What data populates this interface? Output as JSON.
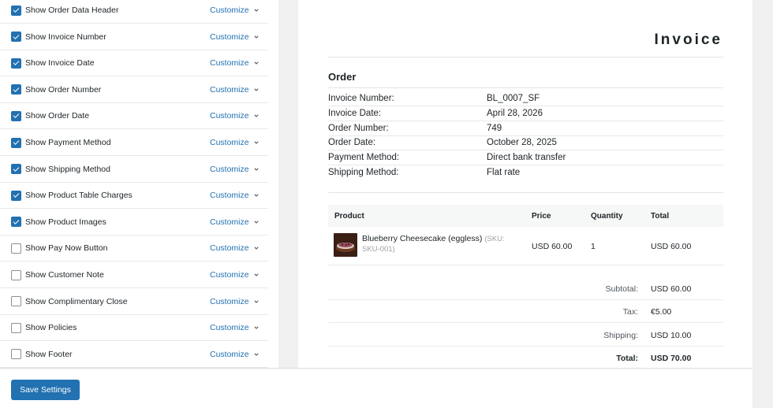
{
  "options": [
    {
      "label": "Show Order Data Header",
      "checked": true
    },
    {
      "label": "Show Invoice Number",
      "checked": true
    },
    {
      "label": "Show Invoice Date",
      "checked": true
    },
    {
      "label": "Show Order Number",
      "checked": true
    },
    {
      "label": "Show Order Date",
      "checked": true
    },
    {
      "label": "Show Payment Method",
      "checked": true
    },
    {
      "label": "Show Shipping Method",
      "checked": true
    },
    {
      "label": "Show Product Table Charges",
      "checked": true
    },
    {
      "label": "Show Product Images",
      "checked": true
    },
    {
      "label": "Show Pay Now Button",
      "checked": false
    },
    {
      "label": "Show Customer Note",
      "checked": false
    },
    {
      "label": "Show Complimentary Close",
      "checked": false
    },
    {
      "label": "Show Policies",
      "checked": false
    },
    {
      "label": "Show Footer",
      "checked": false
    }
  ],
  "customize_label": "Customize",
  "invoice": {
    "title": "Invoice",
    "order_heading": "Order",
    "details": [
      {
        "key": "Invoice Number:",
        "value": "BL_0007_SF"
      },
      {
        "key": "Invoice Date:",
        "value": "April 28, 2026"
      },
      {
        "key": "Order Number:",
        "value": "749"
      },
      {
        "key": "Order Date:",
        "value": "October 28, 2025"
      },
      {
        "key": "Payment Method:",
        "value": "Direct bank transfer"
      },
      {
        "key": "Shipping Method:",
        "value": "Flat rate"
      }
    ],
    "table_headers": {
      "product": "Product",
      "price": "Price",
      "quantity": "Quantity",
      "total": "Total"
    },
    "product": {
      "name": "Blueberry Cheesecake (eggless)",
      "sku": "(SKU: SKU-001)",
      "price": "USD 60.00",
      "quantity": "1",
      "total": "USD 60.00"
    },
    "totals": [
      {
        "key": "Subtotal:",
        "value": "USD 60.00"
      },
      {
        "key": "Tax:",
        "value": "€5.00"
      },
      {
        "key": "Shipping:",
        "value": "USD 10.00"
      },
      {
        "key": "Total:",
        "value": "USD 70.00"
      }
    ]
  },
  "save_button": "Save Settings",
  "colors": {
    "accent": "#2271b1"
  }
}
